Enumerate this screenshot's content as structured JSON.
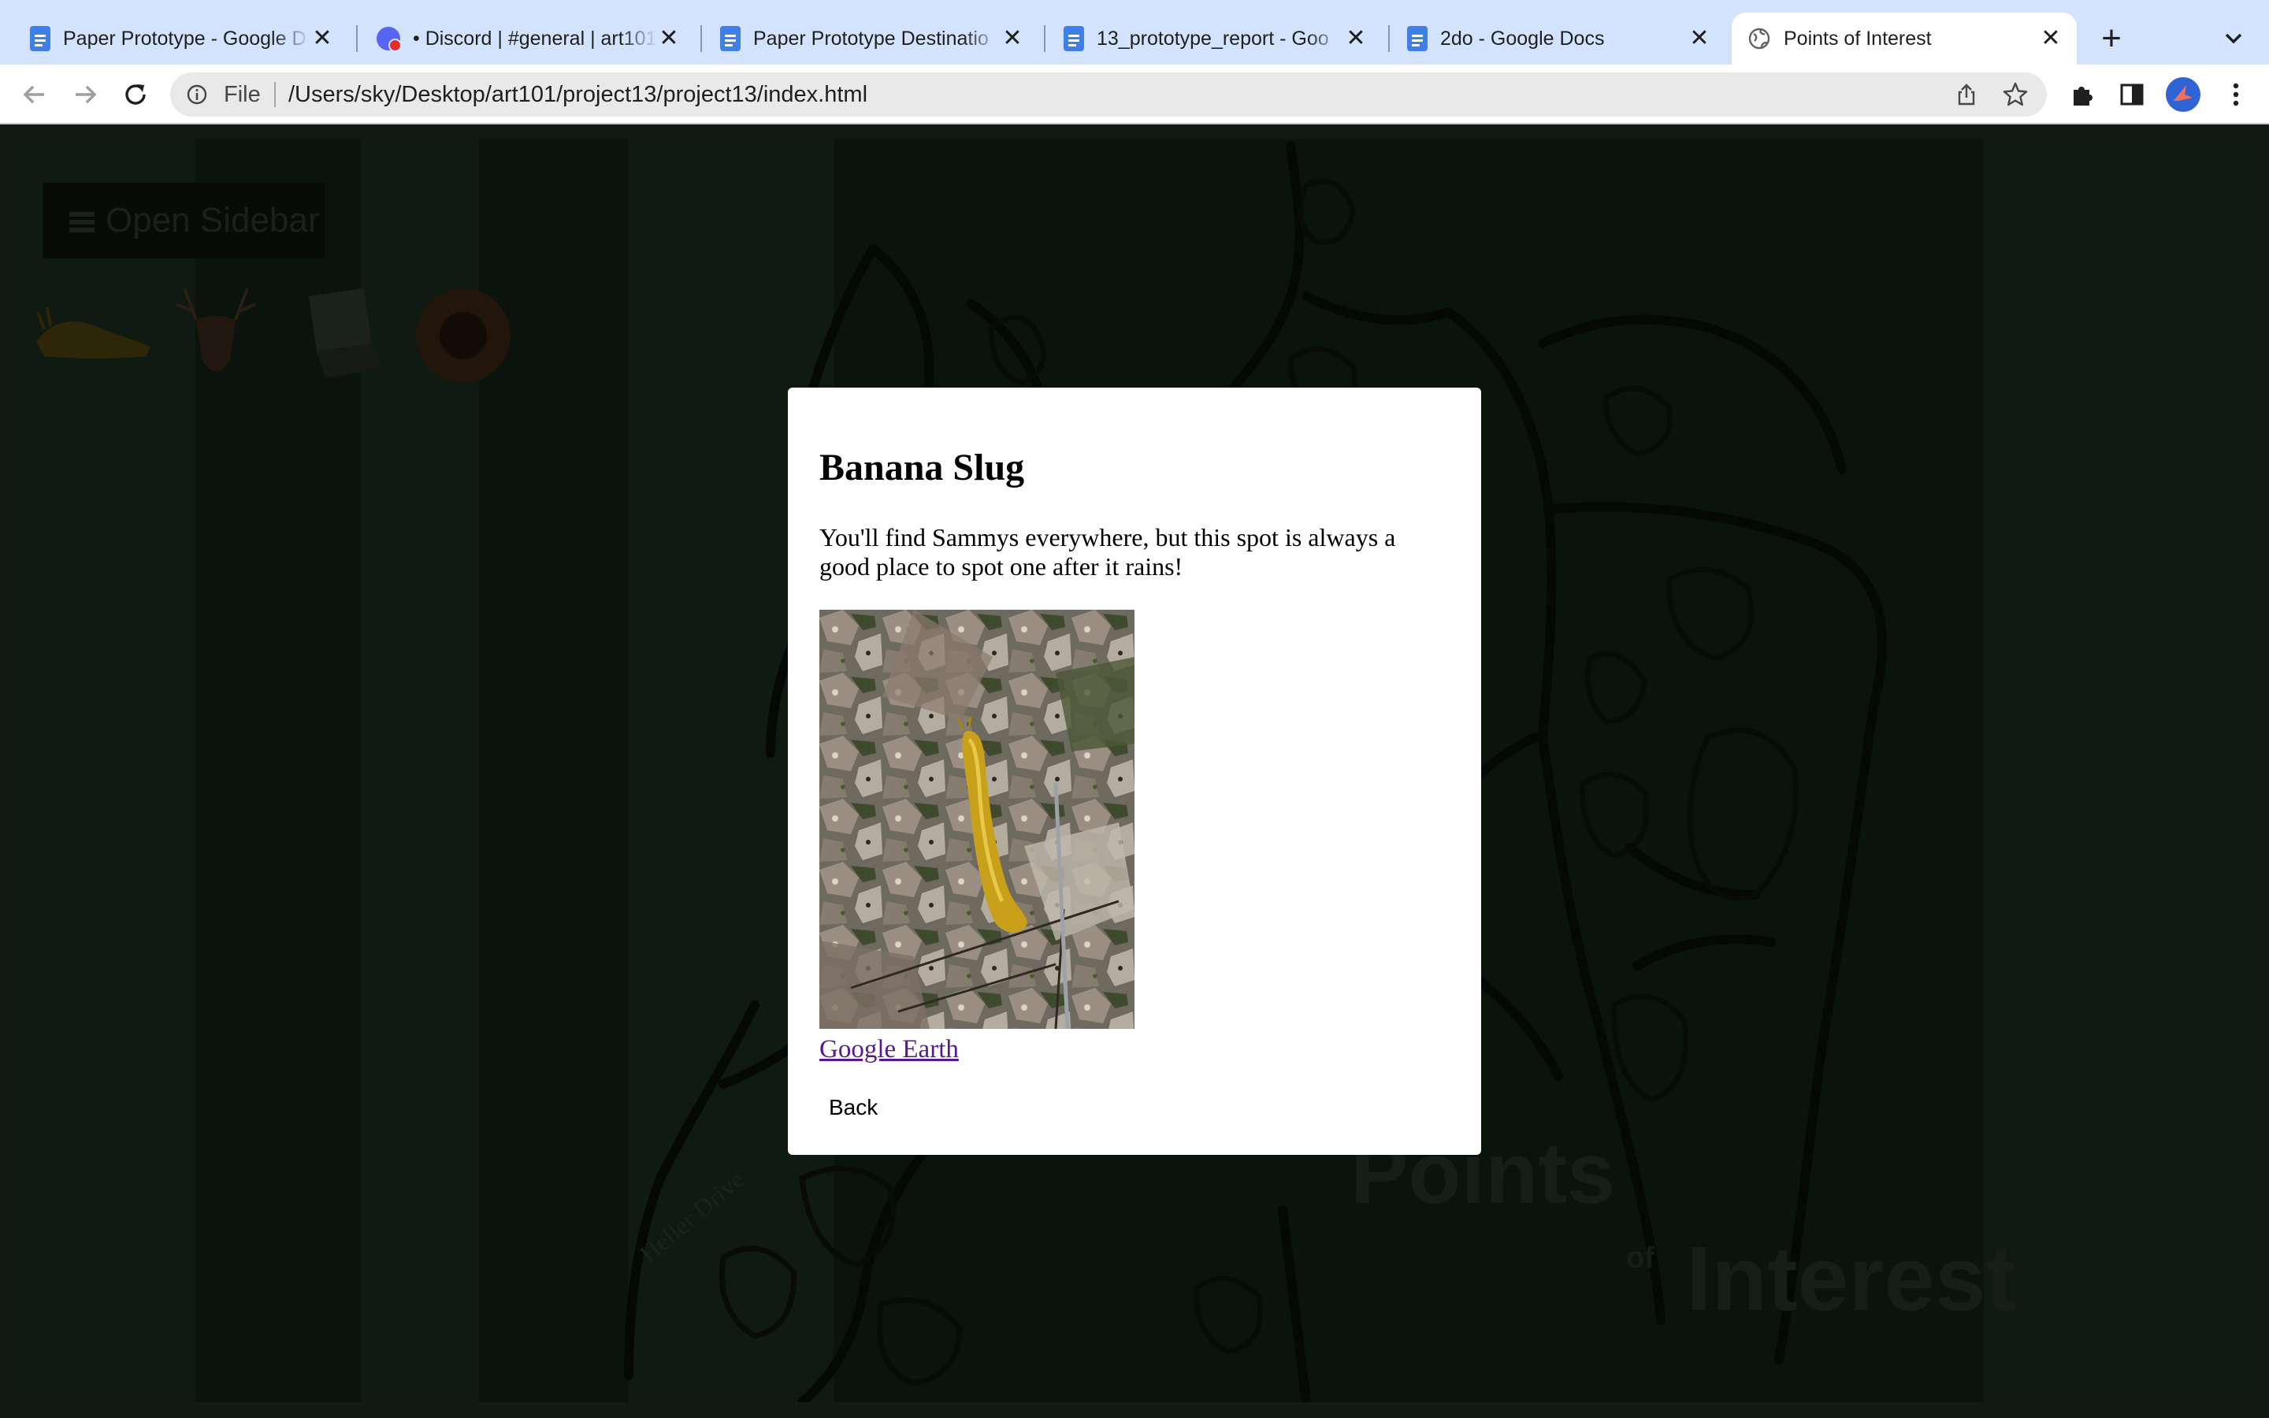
{
  "browser": {
    "tabs": [
      {
        "title": "Paper Prototype - Google D",
        "icon": "docs-icon",
        "active": false
      },
      {
        "title": "• Discord | #general | art101",
        "icon": "discord-icon",
        "active": false
      },
      {
        "title": "Paper Prototype Destinatio",
        "icon": "docs-icon",
        "active": false
      },
      {
        "title": "13_prototype_report - Goo",
        "icon": "docs-icon",
        "active": false
      },
      {
        "title": "2do - Google Docs",
        "icon": "docs-icon",
        "active": false
      },
      {
        "title": "Points of Interest",
        "icon": "globe-icon",
        "active": true
      }
    ],
    "new_tab": "+",
    "omnibox": {
      "scheme": "File",
      "url": "/Users/sky/Desktop/art101/project13/project13/index.html"
    }
  },
  "page": {
    "open_sidebar_label": "Open Sidebar",
    "poi_icons": [
      "slug-icon",
      "deer-icon",
      "laptop-icon",
      "sunflower-icon"
    ],
    "title_words": [
      "Points",
      "of",
      "Interest"
    ],
    "street_labels": [
      "Heller Drive"
    ]
  },
  "modal": {
    "title": "Banana Slug",
    "description": "You'll find Sammys everywhere, but this spot is always a good place to spot one after it rains!",
    "link_label": "Google Earth",
    "back_label": "Back"
  },
  "colors": {
    "tabstrip": "#d3e3fd",
    "overlay": "#0b130d",
    "link": "#551a8b",
    "slug": "#c9a019"
  }
}
